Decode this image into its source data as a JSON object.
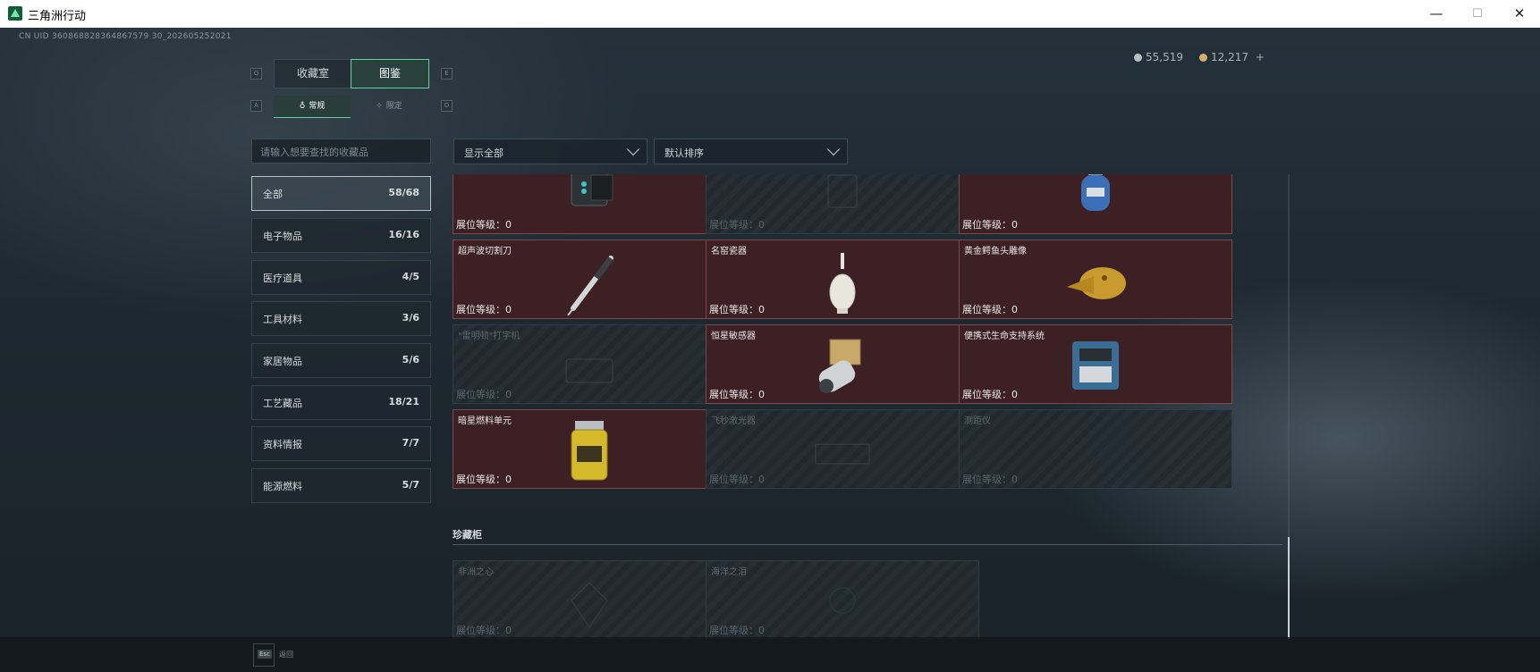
{
  "window": {
    "title": "三角洲行动",
    "minimize": "—",
    "maximize": "☐",
    "close": "✕"
  },
  "uid": "CN UID 360868828364867579 30_202605252021",
  "currency": {
    "silver": "55,519",
    "gold": "12,217",
    "add": "+"
  },
  "tabs": [
    {
      "label": "收藏室",
      "key": "Q"
    },
    {
      "label": "图鉴",
      "key": "E",
      "active": true
    }
  ],
  "subtabs": [
    {
      "label": "常规",
      "key": "A",
      "active": true
    },
    {
      "label": "限定",
      "key": "D"
    }
  ],
  "search": {
    "placeholder": "请输入想要查找的收藏品"
  },
  "categories": [
    {
      "label": "全部",
      "count": "58/68",
      "active": true
    },
    {
      "label": "电子物品",
      "count": "16/16"
    },
    {
      "label": "医疗道具",
      "count": "4/5"
    },
    {
      "label": "工具材料",
      "count": "3/6"
    },
    {
      "label": "家居物品",
      "count": "5/6"
    },
    {
      "label": "工艺藏品",
      "count": "18/21"
    },
    {
      "label": "资料情报",
      "count": "7/7"
    },
    {
      "label": "能源燃料",
      "count": "5/7"
    }
  ],
  "filters": {
    "show": "显示全部",
    "sort": "默认排序"
  },
  "level_label": "展位等级：0",
  "items": [
    {
      "name": "",
      "owned": true,
      "icon": "device-icon"
    },
    {
      "name": "",
      "owned": false,
      "icon": "locked-item-icon"
    },
    {
      "name": "",
      "owned": true,
      "icon": "gas-canister-icon"
    },
    {
      "name": "超声波切割刀",
      "owned": true,
      "icon": "ultrasonic-cutter-icon"
    },
    {
      "name": "名窑瓷器",
      "owned": true,
      "icon": "porcelain-vase-icon"
    },
    {
      "name": "黄金鳄鱼头雕像",
      "owned": true,
      "icon": "gold-crocodile-icon"
    },
    {
      "name": "\"雷明顿\"打字机",
      "owned": false,
      "icon": "typewriter-icon"
    },
    {
      "name": "恒星敏感器",
      "owned": true,
      "icon": "star-sensor-icon"
    },
    {
      "name": "便携式生命支持系统",
      "owned": true,
      "icon": "life-support-icon"
    },
    {
      "name": "暗星燃料单元",
      "owned": true,
      "icon": "fuel-cell-icon"
    },
    {
      "name": "飞秒激光器",
      "owned": false,
      "icon": "laser-icon"
    },
    {
      "name": "测距仪",
      "owned": false,
      "icon": "rangefinder-icon"
    }
  ],
  "treasure": {
    "title": "珍藏柜",
    "items": [
      {
        "name": "非洲之心",
        "owned": false,
        "icon": "gem-icon"
      },
      {
        "name": "海洋之泪",
        "owned": false,
        "icon": "pearl-icon"
      }
    ]
  },
  "footer": {
    "esc_key": "Esc",
    "esc_label": "返回"
  }
}
